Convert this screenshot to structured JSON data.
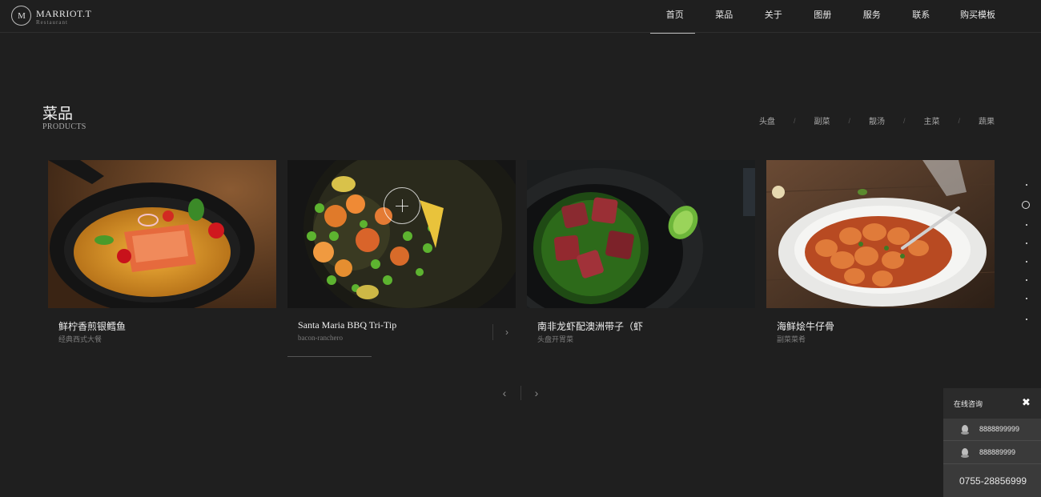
{
  "brand": {
    "name": "MARRIOT.T",
    "subtitle": "Restaurant",
    "monogram": "M"
  },
  "nav": {
    "items": [
      {
        "label": "首页",
        "active": true
      },
      {
        "label": "菜品"
      },
      {
        "label": "关于"
      },
      {
        "label": "图册"
      },
      {
        "label": "服务"
      },
      {
        "label": "联系"
      },
      {
        "label": "购买模板"
      }
    ]
  },
  "section": {
    "title": "菜品",
    "subtitle": "PRODUCTS",
    "filters": [
      "头盘",
      "副菜",
      "靓汤",
      "主菜",
      "蔬果"
    ],
    "filter_separator": "/"
  },
  "products": [
    {
      "title": "鲜柠香煎银鳕鱼",
      "subtitle": "经典西式大餐",
      "image_icon": "salmon-skillet-dish"
    },
    {
      "title": "Santa Maria BBQ Tri-Tip",
      "subtitle": "bacon-ranchero",
      "image_icon": "vegetable-plate-dish",
      "arrow": "›"
    },
    {
      "title": "南非龙虾配澳洲带子（虾",
      "subtitle": "头盘开胃菜",
      "image_icon": "steak-pesto-dish"
    },
    {
      "title": "海鲜烩牛仔骨",
      "subtitle": "副菜菜肴",
      "image_icon": "gnocchi-tomato-dish"
    }
  ],
  "pager": {
    "prev": "‹",
    "next": "›"
  },
  "chat": {
    "title": "在线咨询",
    "close_icon": "✖",
    "contacts": [
      {
        "label": "8888899999",
        "icon": "qq-icon"
      },
      {
        "label": "888889999",
        "icon": "qq-icon"
      }
    ],
    "phone": "0755-28856999"
  },
  "colors": {
    "background": "#1f1f1f",
    "chat_panel": "#3a3a3a",
    "text": "#f0f0f0"
  }
}
